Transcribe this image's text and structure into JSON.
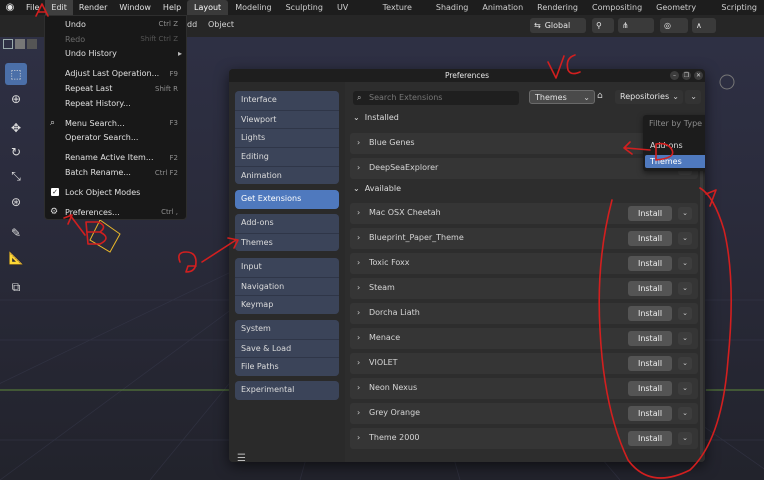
{
  "menubar": {
    "items": [
      "File",
      "Edit",
      "Render",
      "Window",
      "Help"
    ],
    "workspaces": [
      "Layout",
      "Modeling",
      "Sculpting",
      "UV Editing",
      "Texture Paint",
      "Shading",
      "Animation",
      "Rendering",
      "Compositing",
      "Geometry Nodes",
      "Scripting"
    ]
  },
  "header": {
    "add_label": "dd",
    "object_label": "Object",
    "transform_orientation": "Global"
  },
  "edit_menu": {
    "undo": "Undo",
    "undo_sc": "Ctrl Z",
    "redo": "Redo",
    "redo_sc": "Shift Ctrl Z",
    "undo_history": "Undo History",
    "adjust_last": "Adjust Last Operation...",
    "adjust_last_sc": "F9",
    "repeat_last": "Repeat Last",
    "repeat_last_sc": "Shift R",
    "repeat_history": "Repeat History...",
    "menu_search": "Menu Search...",
    "menu_search_sc": "F3",
    "operator_search": "Operator Search...",
    "rename_active": "Rename Active Item...",
    "rename_active_sc": "F2",
    "batch_rename": "Batch Rename...",
    "batch_rename_sc": "Ctrl F2",
    "lock_object_modes": "Lock Object Modes",
    "preferences": "Preferences...",
    "preferences_sc": "Ctrl ,"
  },
  "prefs": {
    "title": "Preferences",
    "nav_groups": [
      [
        "Interface",
        "Viewport",
        "Lights",
        "Editing",
        "Animation"
      ],
      [
        "Get Extensions"
      ],
      [
        "Add-ons",
        "Themes"
      ],
      [
        "Input",
        "Navigation",
        "Keymap"
      ],
      [
        "System",
        "Save & Load",
        "File Paths"
      ],
      [
        "Experimental"
      ]
    ],
    "search_placeholder": "Search Extensions",
    "type_filter": "Themes",
    "repositories_label": "Repositories",
    "installed_header": "Installed",
    "available_header": "Available",
    "installed": [
      "Blue Genes",
      "DeepSeaExplorer"
    ],
    "available": [
      "Mac OSX Cheetah",
      "Blueprint_Paper_Theme",
      "Toxic Foxx",
      "Steam",
      "Dorcha Liath",
      "Menace",
      "VIOLET",
      "Neon Nexus",
      "Grey Orange",
      "Theme 2000"
    ],
    "install_label": "Install",
    "filter_popup": {
      "title": "Filter by Type",
      "items": [
        "Add-ons",
        "Themes"
      ]
    }
  },
  "annotations": {
    "labels": [
      "A",
      "B",
      "C",
      "D",
      "E",
      "G"
    ],
    "color": "#d21f1f"
  },
  "colors": {
    "accent": "#4f79be",
    "annotation": "#d21f1f"
  }
}
